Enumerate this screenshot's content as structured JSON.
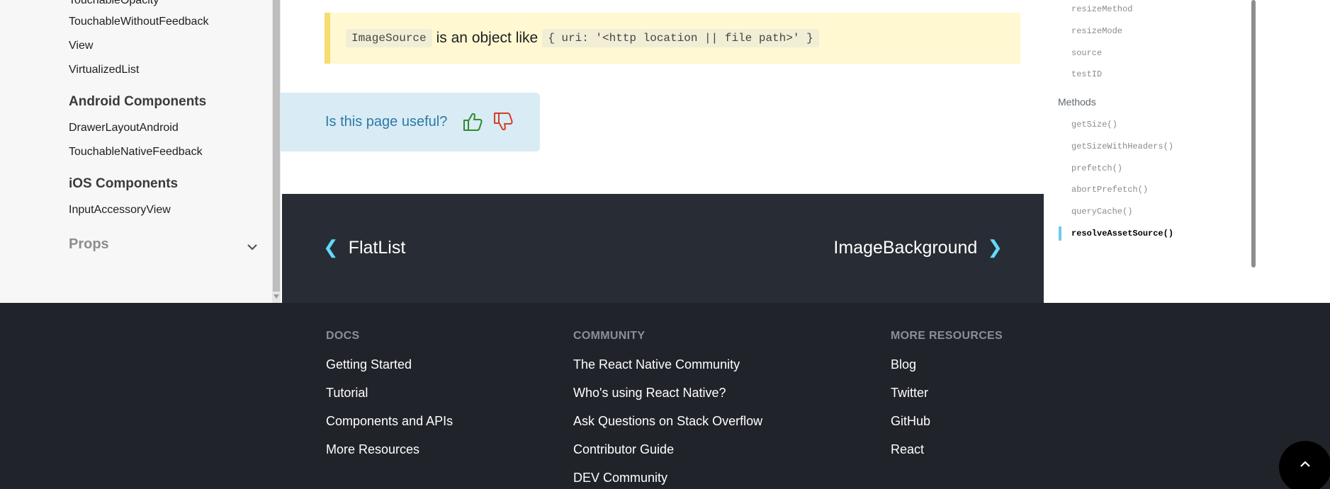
{
  "sidebar": {
    "links_top": [
      "TouchableOpacity",
      "TouchableWithoutFeedback",
      "View",
      "VirtualizedList"
    ],
    "android": {
      "heading": "Android Components",
      "links": [
        "DrawerLayoutAndroid",
        "TouchableNativeFeedback"
      ]
    },
    "ios": {
      "heading": "iOS Components",
      "links": [
        "InputAccessoryView"
      ]
    },
    "props_label": "Props"
  },
  "callout": {
    "code1": "ImageSource",
    "text": "is an object like",
    "code2": "{ uri: '<http location || file path>' }"
  },
  "feedback": {
    "question": "Is this page useful?"
  },
  "pager": {
    "prev_label": "FlatList",
    "next_label": "ImageBackground"
  },
  "toc": {
    "props_items": [
      "resizeMethod",
      "resizeMode",
      "source",
      "testID"
    ],
    "methods_label": "Methods",
    "methods_items": [
      "getSize()",
      "getSizeWithHeaders()",
      "prefetch()",
      "abortPrefetch()",
      "queryCache()",
      "resolveAssetSource()"
    ]
  },
  "footer": {
    "docs": {
      "title": "DOCS",
      "links": [
        "Getting Started",
        "Tutorial",
        "Components and APIs",
        "More Resources"
      ]
    },
    "community": {
      "title": "COMMUNITY",
      "links": [
        "The React Native Community",
        "Who's using React Native?",
        "Ask Questions on Stack Overflow",
        "Contributor Guide",
        "DEV Community"
      ]
    },
    "more": {
      "title": "MORE RESOURCES",
      "links": [
        "Blog",
        "Twitter",
        "GitHub",
        "React"
      ]
    }
  },
  "colors": {
    "accent": "#61dafb",
    "footer_bg": "#20232a",
    "pager_bg": "#282c34",
    "callout_bg": "#fff8d1",
    "feedback_bg": "#d9ebf4"
  },
  "icons": {
    "thumbs_up": "thumbs-up-icon",
    "thumbs_down": "thumbs-down-icon",
    "back_to_top": "arrow-up-icon"
  }
}
